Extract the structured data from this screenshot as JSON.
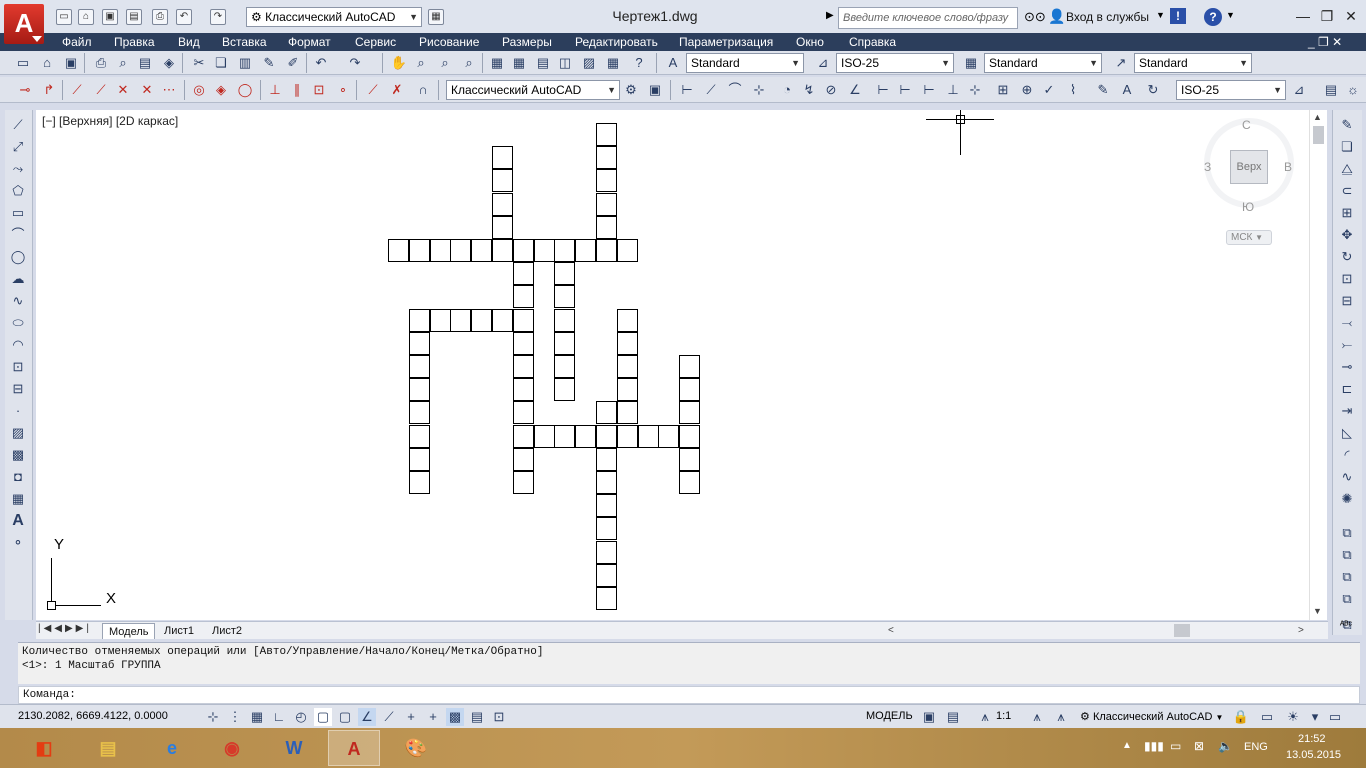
{
  "titlebar": {
    "doc_title": "Чертеж1.dwg",
    "workspace": "Классический AutoCAD",
    "search_placeholder": "Введите ключевое слово/фразу",
    "login": "Вход в службы"
  },
  "menu": [
    "Файл",
    "Правка",
    "Вид",
    "Вставка",
    "Формат",
    "Сервис",
    "Рисование",
    "Размеры",
    "Редактировать",
    "Параметризация",
    "Окно",
    "Справка"
  ],
  "styles_toolbar": {
    "text_style": "Standard",
    "dim_style": "ISO-25",
    "table_style": "Standard",
    "mleader_style": "Standard"
  },
  "toolbar3": {
    "workspace_combo": "Классический AutoCAD",
    "dim_style_combo": "ISO-25"
  },
  "viewport": {
    "label": "[−] [Верхняя] [2D каркас]",
    "viewcube": {
      "north": "С",
      "south": "Ю",
      "west": "З",
      "east": "В",
      "face": "Верх",
      "ucs": "МСК"
    },
    "ucs_x": "X",
    "ucs_y": "Y"
  },
  "tabs": [
    "Модель",
    "Лист1",
    "Лист2"
  ],
  "command": {
    "history_line1": "Количество отменяемых операций или [Авто/Управление/Начало/Конец/Метка/Обратно]",
    "history_line2": "<1>: 1 Масштаб ГРУППА",
    "prompt": "Команда:"
  },
  "status": {
    "coords": "2130.2082, 6669.4122, 0.0000",
    "model": "МОДЕЛЬ",
    "scale": "1:1",
    "workspace": "Классический AutoCAD"
  },
  "tray": {
    "lang": "ENG",
    "time": "21:52",
    "date": "13.05.2015"
  },
  "colors": {
    "menubar": "#2c3e5c",
    "toolbar": "#dfe3ec",
    "canvas": "#ffffff",
    "autocad_red": "#c0281f"
  }
}
